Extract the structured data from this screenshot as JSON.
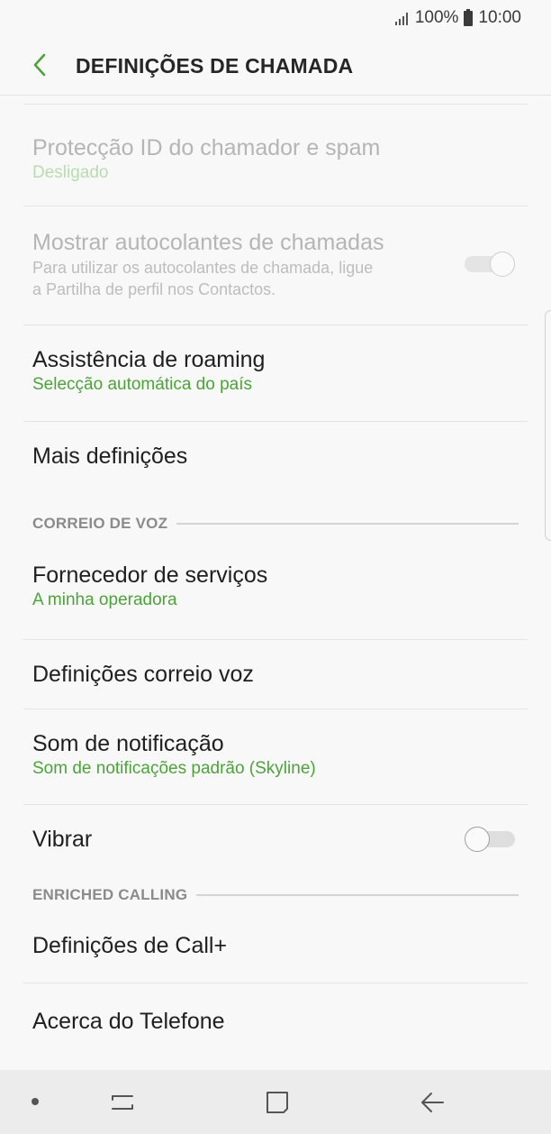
{
  "status": {
    "battery": "100%",
    "time": "10:00"
  },
  "header": {
    "title": "DEFINIÇÕES DE CHAMADA"
  },
  "items": [
    {
      "title": "Protecção ID do chamador e spam",
      "sub": "Desligado"
    },
    {
      "title": "Mostrar autocolantes de chamadas",
      "desc1": "Para utilizar os autocolantes de chamada, ligue",
      "desc2": "a Partilha de perfil nos Contactos."
    },
    {
      "title": "Assistência de roaming",
      "sub": "Selecção automática do país"
    },
    {
      "title": "Mais definições"
    }
  ],
  "voicemail": {
    "header": "CORREIO DE VOZ",
    "items": [
      {
        "title": "Fornecedor de serviços",
        "sub": "A minha operadora"
      },
      {
        "title": "Definições correio voz"
      },
      {
        "title": "Som de notificação",
        "sub": "Som de notificações padrão (Skyline)"
      },
      {
        "title": "Vibrar"
      }
    ]
  },
  "enriched": {
    "header": "ENRICHED CALLING",
    "items": [
      {
        "title": "Definições de Call+"
      },
      {
        "title": "Acerca do Telefone"
      }
    ]
  },
  "colors": {
    "accent": "#4ca33a",
    "text": "#202020",
    "disabled": "#b5b5b5"
  }
}
